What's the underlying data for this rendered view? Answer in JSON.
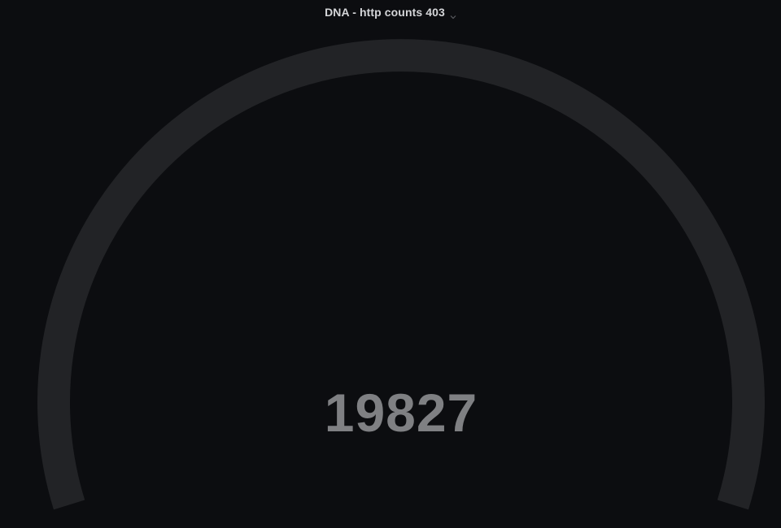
{
  "panel": {
    "title": "DNA - http counts 403",
    "menu_icon": "chevron-down-icon"
  },
  "gauge": {
    "value": "19827",
    "track_color": "#222326",
    "value_color": "#7f8083",
    "background_color": "#0c0d10"
  }
}
